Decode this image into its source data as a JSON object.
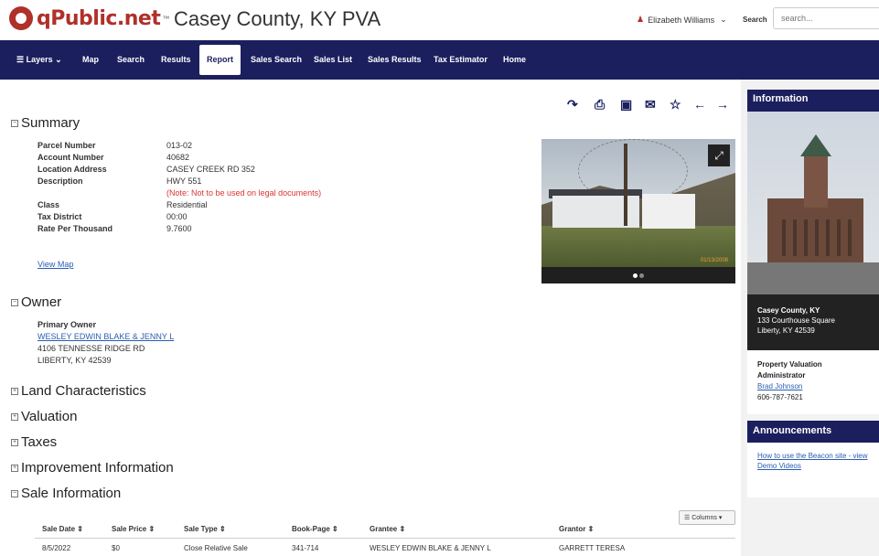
{
  "header": {
    "logo_text": "qPublic.net",
    "logo_tm": "™",
    "title": "Casey County, KY PVA",
    "user_name": "Elizabeth Williams",
    "search_label": "Search",
    "search_placeholder": "search..."
  },
  "nav": {
    "layers": "Layers",
    "map": "Map",
    "search": "Search",
    "results": "Results",
    "report": "Report",
    "sales_search": "Sales Search",
    "sales_list": "Sales List",
    "sales_results": "Sales Results",
    "tax_estimator": "Tax Estimator",
    "home": "Home"
  },
  "summary": {
    "title": "Summary",
    "labels": [
      "Parcel Number",
      "Account Number",
      "Location Address",
      "Description",
      "Class",
      "Tax District",
      "Rate Per Thousand"
    ],
    "parcel_number": "013-02",
    "account_number": "40682",
    "location_address": "CASEY CREEK RD 352",
    "description": "HWY 551",
    "description_note": "(Note: Not to be used on legal documents)",
    "class": "Residential",
    "tax_district": "00:00",
    "rate_per_thousand": "9.7600",
    "view_map": "View Map"
  },
  "owner": {
    "title": "Owner",
    "primary_owner_label": "Primary Owner",
    "name": "WESLEY EDWIN BLAKE & JENNY L",
    "address1": "4106 TENNESSE RIDGE RD",
    "address2": "LIBERTY, KY 42539"
  },
  "sections": {
    "land": "Land Characteristics",
    "valuation": "Valuation",
    "taxes": "Taxes",
    "improvement": "Improvement Information",
    "sale": "Sale Information"
  },
  "photo": {
    "date_stamp": "01/13/2008"
  },
  "sidebar": {
    "info_header": "Information",
    "county": "Casey County, KY",
    "street": "133 Courthouse Square",
    "city": "Liberty, KY 42539",
    "pva_title_1": "Property Valuation",
    "pva_title_2": "Administrator",
    "pva_name": "Brad Johnson",
    "pva_phone": "606-787-7621",
    "announcements_header": "Announcements",
    "announcement_link_1": "How to use the Beacon site - view",
    "announcement_link_2": "Demo Videos"
  },
  "sales": {
    "columns_button": "Columns",
    "headers": [
      "Sale Date",
      "Sale Price",
      "Sale Type",
      "Book-Page",
      "Grantee",
      "Grantor"
    ],
    "rows": [
      [
        "8/5/2022",
        "$0",
        "Close Relative Sale",
        "341-714",
        "WESLEY EDWIN BLAKE & JENNY L",
        "GARRETT TERESA"
      ]
    ]
  },
  "colors": {
    "nav_bg": "#1b1f5e",
    "brand_red": "#b0302a",
    "link_blue": "#2a5db0",
    "note_red": "#dd3333"
  }
}
